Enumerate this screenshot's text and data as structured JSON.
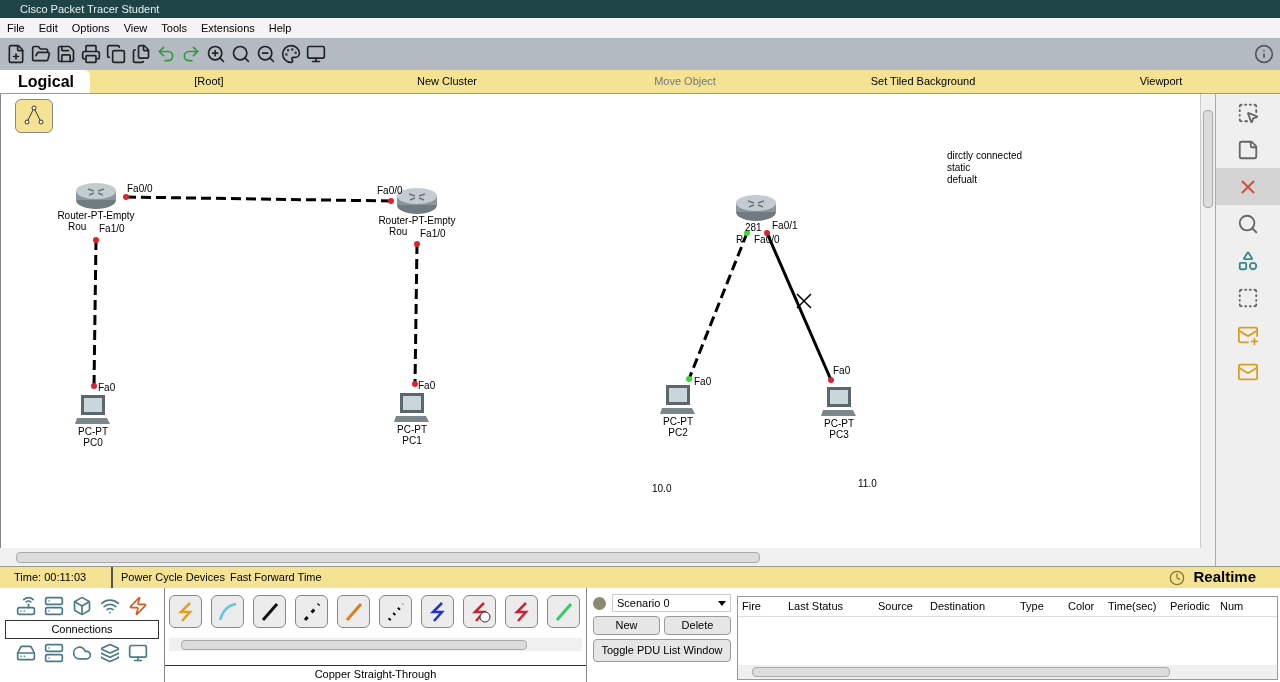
{
  "window": {
    "title": "Cisco Packet Tracer Student"
  },
  "menu": [
    "File",
    "Edit",
    "Options",
    "View",
    "Tools",
    "Extensions",
    "Help"
  ],
  "workspace_bar": {
    "tab": "Logical",
    "items": [
      "[Root]",
      "New Cluster",
      "Move Object",
      "Set Tiled Background",
      "Viewport"
    ]
  },
  "canvas": {
    "devices": [
      {
        "kind": "router",
        "model": "Router-PT-Empty",
        "name": "Rou"
      },
      {
        "kind": "router",
        "model": "Router-PT-Empty",
        "name": "Rou"
      },
      {
        "kind": "router",
        "model": "281",
        "name": "R"
      },
      {
        "kind": "pc",
        "model": "PC-PT",
        "name": "PC0"
      },
      {
        "kind": "pc",
        "model": "PC-PT",
        "name": "PC1"
      },
      {
        "kind": "pc",
        "model": "PC-PT",
        "name": "PC2"
      },
      {
        "kind": "pc",
        "model": "PC-PT",
        "name": "PC3"
      }
    ],
    "links": [
      {
        "kind": "crossover",
        "end_a": {
          "port": "Fa0/0",
          "up": false
        },
        "end_b": {
          "port": "Fa0/0",
          "up": false
        }
      },
      {
        "kind": "crossover",
        "end_a": {
          "port": "Fa1/0",
          "up": false
        },
        "end_b": {
          "port": "Fa0",
          "up": false
        }
      },
      {
        "kind": "crossover",
        "end_a": {
          "port": "Fa1/0",
          "up": false
        },
        "end_b": {
          "port": "Fa0",
          "up": false
        }
      },
      {
        "kind": "crossover",
        "end_a": {
          "port": "Fa0/0",
          "up": true
        },
        "end_b": {
          "port": "Fa0",
          "up": true
        }
      },
      {
        "kind": "straight",
        "end_a": {
          "port": "Fa0/1",
          "up": false
        },
        "end_b": {
          "port": "Fa0",
          "up": false
        }
      }
    ],
    "note": [
      "dirctly connected",
      "static",
      "defualt"
    ],
    "labels": [
      "10.0",
      "11.0"
    ]
  },
  "right_tools": [
    {
      "selected": false
    },
    {
      "selected": false
    },
    {
      "selected": true
    },
    {
      "selected": false
    },
    {
      "selected": false
    },
    {
      "selected": false
    },
    {
      "selected": false
    },
    {
      "selected": false
    }
  ],
  "status_bar": {
    "time": "Time: 00:11:03",
    "buttons": [
      "Power Cycle Devices",
      "Fast Forward Time"
    ],
    "mode": "Realtime"
  },
  "device_panel": {
    "label": "Connections"
  },
  "connection_panel": {
    "caption": "Copper Straight-Through"
  },
  "scenario": {
    "value": "Scenario 0",
    "buttons": [
      "New",
      "Delete"
    ],
    "toggle": "Toggle PDU List Window"
  },
  "pdu_table": {
    "columns": [
      "Fire",
      "Last Status",
      "Source",
      "Destination",
      "Type",
      "Color",
      "Time(sec)",
      "Periodic",
      "Num"
    ]
  }
}
